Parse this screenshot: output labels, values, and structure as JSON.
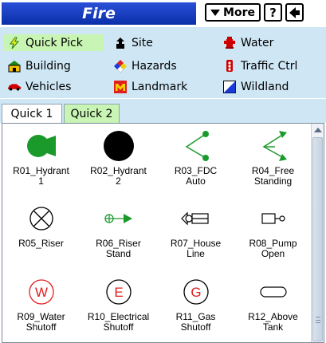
{
  "header": {
    "title": "Fire",
    "more_label": "More",
    "help_label": "?"
  },
  "categories": [
    {
      "id": "quick-pick",
      "label": "Quick Pick",
      "icon": "lightning-icon",
      "selected": true
    },
    {
      "id": "site",
      "label": "Site",
      "icon": "site-marker-icon"
    },
    {
      "id": "water",
      "label": "Water",
      "icon": "hydrant-icon"
    },
    {
      "id": "building",
      "label": "Building",
      "icon": "building-icon"
    },
    {
      "id": "hazards",
      "label": "Hazards",
      "icon": "hazard-diamond-icon"
    },
    {
      "id": "traffic-ctrl",
      "label": "Traffic Ctrl",
      "icon": "traffic-light-icon"
    },
    {
      "id": "vehicles",
      "label": "Vehicles",
      "icon": "car-icon"
    },
    {
      "id": "landmark",
      "label": "Landmark",
      "icon": "landmark-icon"
    },
    {
      "id": "wildland",
      "label": "Wildland",
      "icon": "wildland-icon"
    }
  ],
  "tabs": [
    {
      "label": "Quick 1",
      "selected": false
    },
    {
      "label": "Quick 2",
      "selected": true
    }
  ],
  "symbols": [
    {
      "label": "R01_Hydrant\n1",
      "icon": "green-hydrant-icon"
    },
    {
      "label": "R02_Hydrant\n2",
      "icon": "black-circle-icon"
    },
    {
      "label": "R03_FDC\nAuto",
      "icon": "fdc-auto-icon"
    },
    {
      "label": "R04_Free\nStanding",
      "icon": "fdc-free-standing-icon"
    },
    {
      "label": "R05_Riser",
      "icon": "riser-icon"
    },
    {
      "label": "R06_Riser\nStand",
      "icon": "riser-stand-icon"
    },
    {
      "label": "R07_House\nLine",
      "icon": "house-line-icon"
    },
    {
      "label": "R08_Pump\nOpen",
      "icon": "pump-open-icon"
    },
    {
      "label": "R09_Water\nShutoff",
      "icon": "water-shutoff-icon",
      "letter": "W"
    },
    {
      "label": "R10_Electrical\nShutoff",
      "icon": "electrical-shutoff-icon",
      "letter": "E"
    },
    {
      "label": "R11_Gas\nShutoff",
      "icon": "gas-shutoff-icon",
      "letter": "G"
    },
    {
      "label": "R12_Above\nTank",
      "icon": "above-tank-icon"
    }
  ],
  "colors": {
    "title_bar": "#0a2fa8",
    "panel_bg": "#cfe7f5",
    "selected_bg": "#c8f5b4",
    "symbol_green": "#1a9a2a",
    "water_red": "#e02020"
  }
}
